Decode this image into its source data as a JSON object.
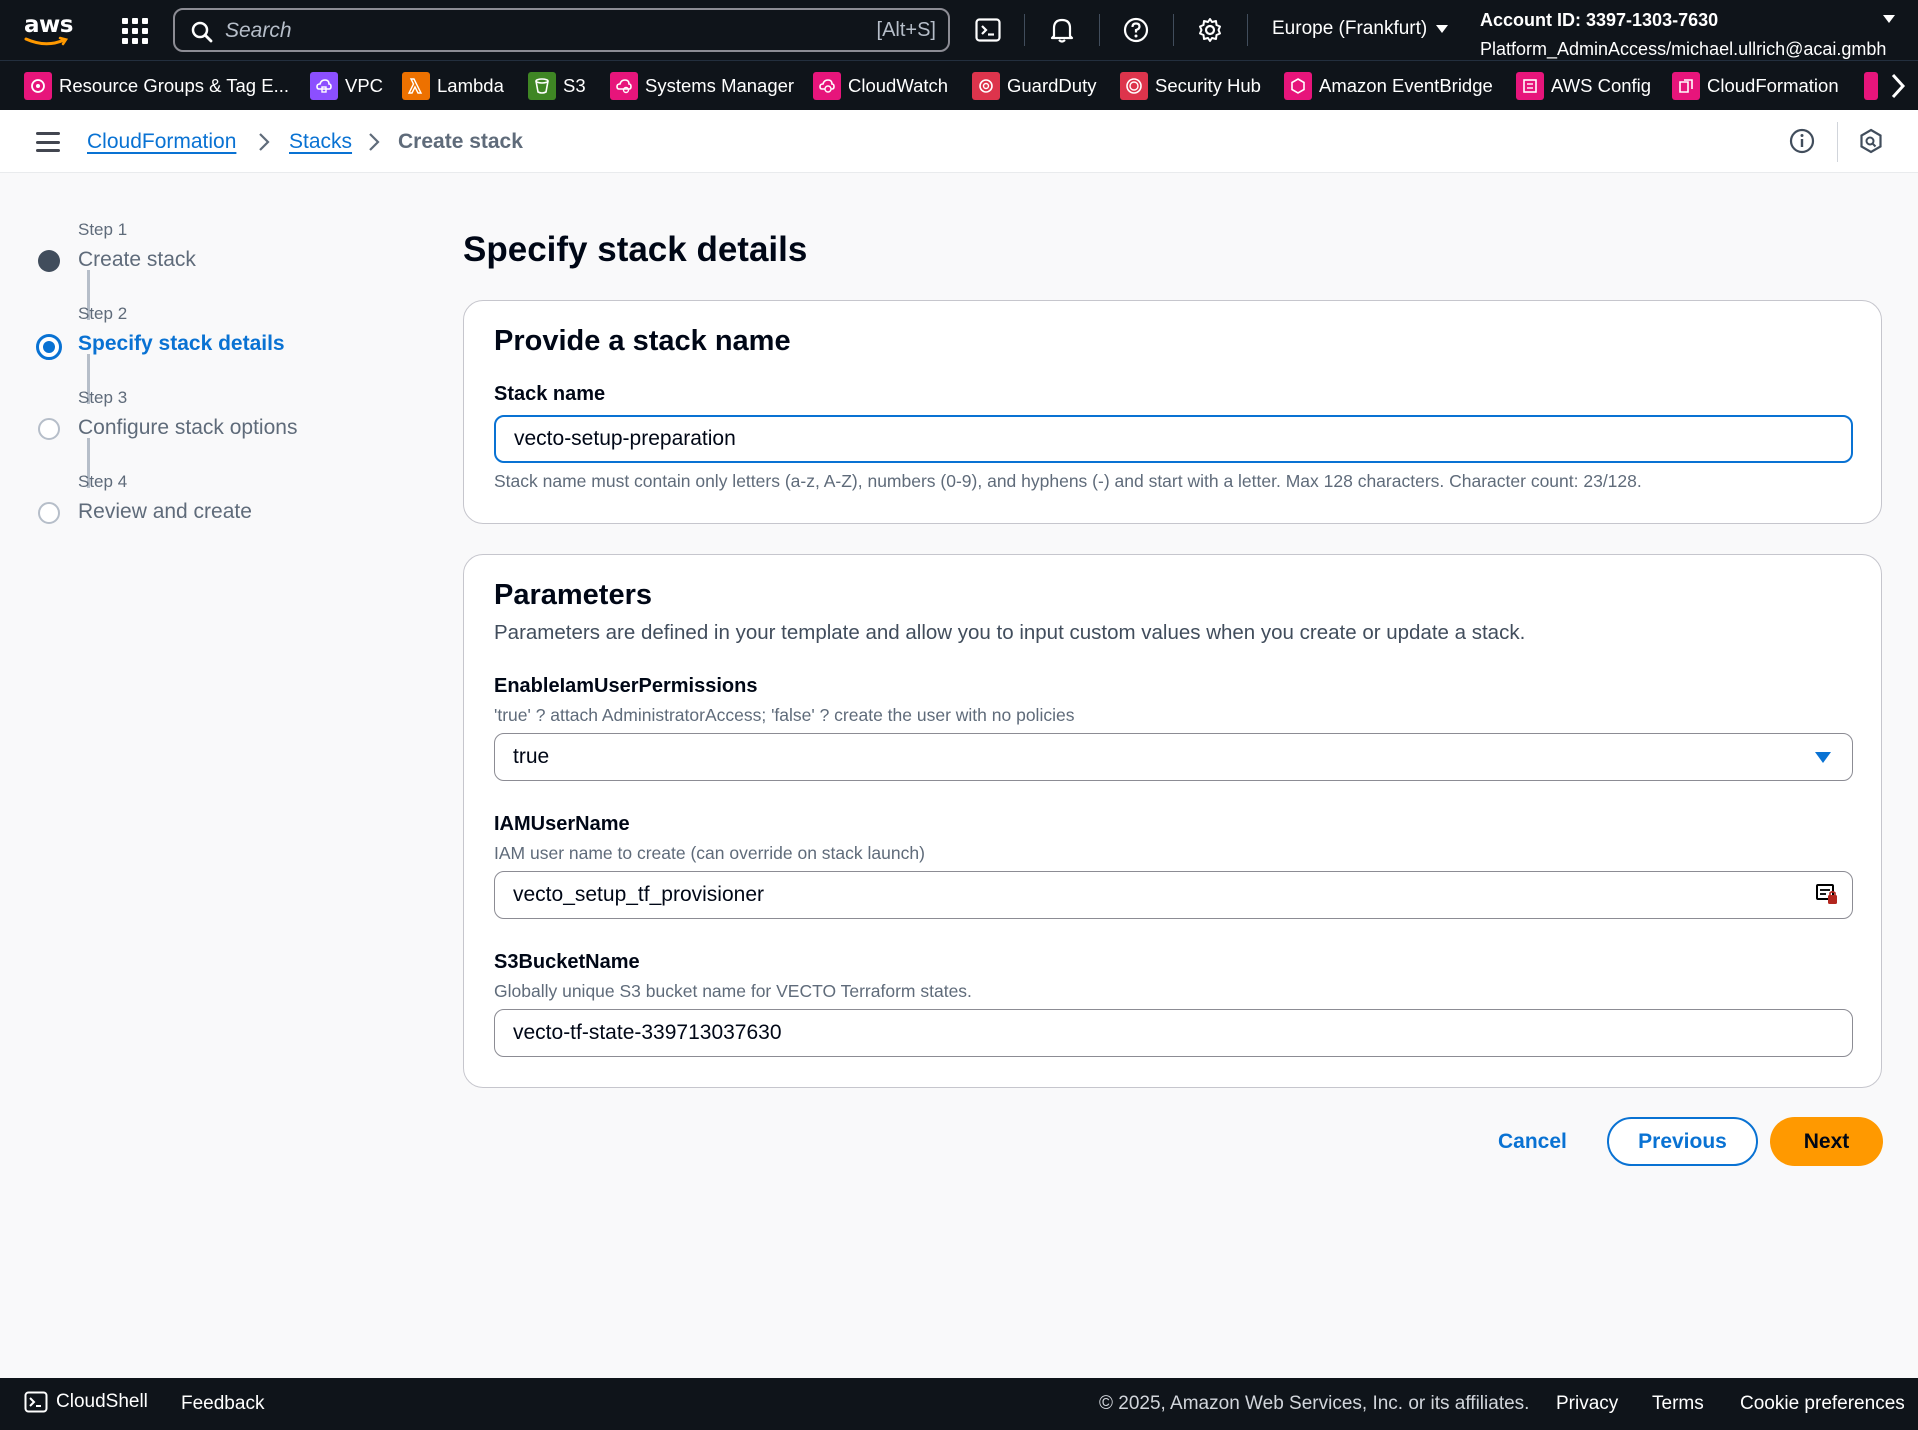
{
  "topnav": {
    "logo_text": "aws",
    "search_placeholder": "Search",
    "search_shortcut": "[Alt+S]",
    "icons": [
      "cloudshell-icon",
      "bell-icon",
      "help-icon",
      "gear-icon"
    ],
    "region": "Europe (Frankfurt)",
    "account_id": "Account ID: 3397-1303-7630",
    "account_role": "Platform_AdminAccess/michael.ullrich@acai.gmbh"
  },
  "favorites": [
    {
      "label": "Resource Groups & Tag E...",
      "color": "#e7157b"
    },
    {
      "label": "VPC",
      "color": "#8c4fff"
    },
    {
      "label": "Lambda",
      "color": "#ed7100"
    },
    {
      "label": "S3",
      "color": "#3f8624"
    },
    {
      "label": "Systems Manager",
      "color": "#e7157b"
    },
    {
      "label": "CloudWatch",
      "color": "#e7157b"
    },
    {
      "label": "GuardDuty",
      "color": "#dd344c"
    },
    {
      "label": "Security Hub",
      "color": "#dd344c"
    },
    {
      "label": "Amazon EventBridge",
      "color": "#e7157b"
    },
    {
      "label": "AWS Config",
      "color": "#e7157b"
    },
    {
      "label": "CloudFormation",
      "color": "#e7157b"
    }
  ],
  "breadcrumb": {
    "items": [
      "CloudFormation",
      "Stacks"
    ],
    "current": "Create stack"
  },
  "wizard": {
    "steps": [
      {
        "number": "Step 1",
        "title": "Create stack",
        "state": "done"
      },
      {
        "number": "Step 2",
        "title": "Specify stack details",
        "state": "current"
      },
      {
        "number": "Step 3",
        "title": "Configure stack options",
        "state": "pending"
      },
      {
        "number": "Step 4",
        "title": "Review and create",
        "state": "pending"
      }
    ]
  },
  "main": {
    "page_title": "Specify stack details",
    "stack_name_card": {
      "title": "Provide a stack name",
      "label": "Stack name",
      "value": "vecto-setup-preparation",
      "hint": "Stack name must contain only letters (a-z, A-Z), numbers (0-9), and hyphens (-) and start with a letter. Max 128 characters. Character count: 23/128."
    },
    "parameters_card": {
      "title": "Parameters",
      "description": "Parameters are defined in your template and allow you to input custom values when you create or update a stack.",
      "params": [
        {
          "label": "EnableIamUserPermissions",
          "hint": "'true' ? attach AdministratorAccess; 'false' ? create the user with no policies",
          "value": "true",
          "kind": "select"
        },
        {
          "label": "IAMUserName",
          "hint": "IAM user name to create (can override on stack launch)",
          "value": "vecto_setup_tf_provisioner",
          "kind": "text"
        },
        {
          "label": "S3BucketName",
          "hint": "Globally unique S3 bucket name for VECTO Terraform states.",
          "value": "vecto-tf-state-339713037630",
          "kind": "text"
        }
      ]
    }
  },
  "actions": {
    "cancel": "Cancel",
    "previous": "Previous",
    "next": "Next"
  },
  "footer": {
    "cloudshell": "CloudShell",
    "feedback": "Feedback",
    "copyright": "© 2025, Amazon Web Services, Inc. or its affiliates.",
    "privacy": "Privacy",
    "terms": "Terms",
    "cookie": "Cookie preferences"
  },
  "colors": {
    "accent": "#0972d3",
    "primary_button": "#ff9900",
    "nav_bg": "#0f141a"
  }
}
